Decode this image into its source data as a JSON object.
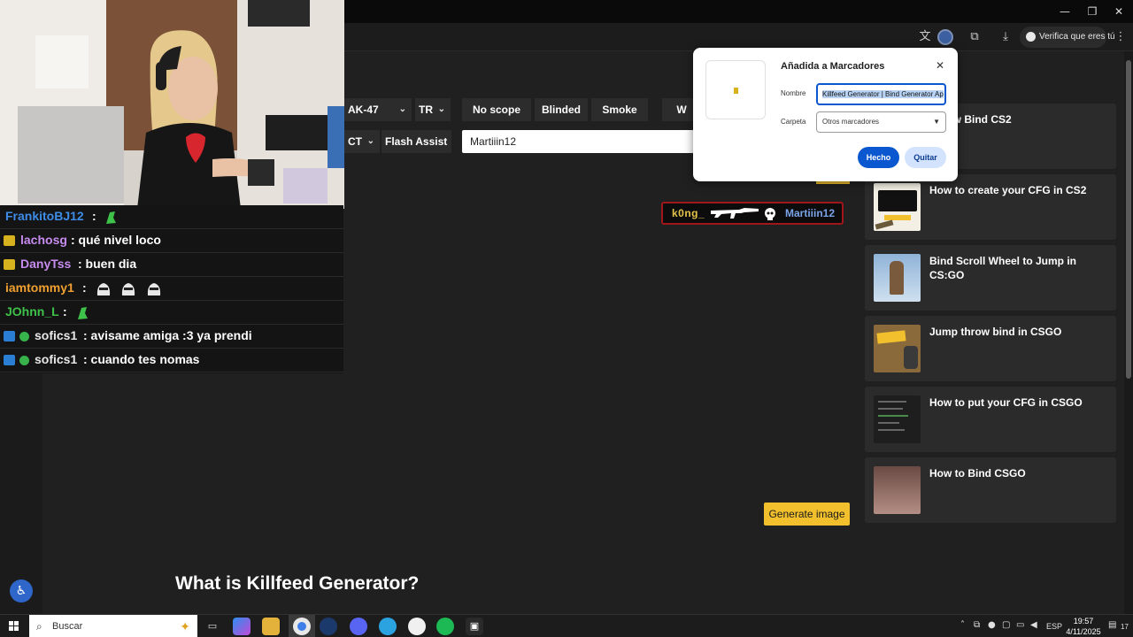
{
  "window": {
    "minimize": "—",
    "restore": "❐",
    "close": "✕"
  },
  "toolbar": {
    "verify_label": "Verifica que eres tú"
  },
  "generator": {
    "weapon_select": "AK-47",
    "team_top_select": "TR",
    "team_bottom_select": "CT",
    "toggles": [
      "No scope",
      "Blinded",
      "Smoke",
      "W"
    ],
    "flash_assist": "Flash Assist",
    "name_value": "Martiiin12",
    "generate_button": "Generate image"
  },
  "killfeed": {
    "killer": "k0ng_",
    "victim": "Martiiin12"
  },
  "section_heading": "What is Killfeed Generator?",
  "cards": [
    {
      "title": "Throw Bind CS2"
    },
    {
      "title": "How to create your CFG in CS2"
    },
    {
      "title": "Bind Scroll Wheel to Jump in CS:GO"
    },
    {
      "title": "Jump throw bind in CSGO"
    },
    {
      "title": "How to put your CFG in CSGO"
    },
    {
      "title": "How to Bind CSGO"
    }
  ],
  "bookmark_popup": {
    "title": "Añadida a Marcadores",
    "name_label": "Nombre",
    "name_value": "Killfeed Generator | Bind Generator Ap",
    "folder_label": "Carpeta",
    "folder_value": "Otros marcadores",
    "done_button": "Hecho",
    "remove_button": "Quitar"
  },
  "chat": [
    {
      "user": "FrankitoBJ12",
      "message": ":",
      "user_color": "#3d8ce8",
      "badge": "none"
    },
    {
      "user": "lachosg",
      "message": ": qué nivel loco",
      "user_color": "#c88cf0",
      "badge": "sub"
    },
    {
      "user": "DanyTss",
      "message": ": buen dia",
      "user_color": "#c88cf0",
      "badge": "sub"
    },
    {
      "user": "iamtommy1",
      "message": ":",
      "user_color": "#f0a030",
      "badge": "none"
    },
    {
      "user": "JOhnn_L",
      "message": ":",
      "user_color": "#3ec24a",
      "badge": "none"
    },
    {
      "user": "sofics1",
      "message": ": avisame amiga :3 ya prendi",
      "user_color": "#e8e8e8",
      "badge": "prime"
    },
    {
      "user": "sofics1",
      "message": ": cuando tes nomas",
      "user_color": "#e8e8e8",
      "badge": "prime"
    }
  ],
  "taskbar": {
    "search_placeholder": "Buscar",
    "language": "ESP",
    "time": "19:57",
    "date": "4/11/2025",
    "notifications": "17"
  },
  "colors": {
    "accent_yellow": "#f1c02c",
    "popup_blue": "#0b57d0",
    "killfeed_border": "#a1161b"
  }
}
